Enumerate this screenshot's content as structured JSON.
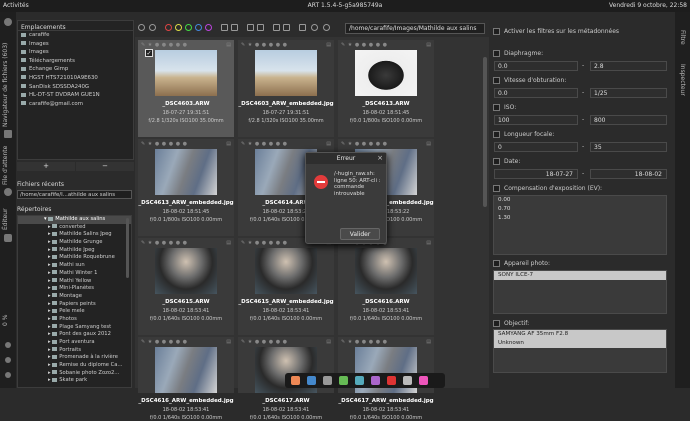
{
  "topbar": {
    "apps": "Activités",
    "title": "ART 1.5.4-5-g5a985749a",
    "clock": "Vendredi 9 octobre, 22:58"
  },
  "left_tabs": {
    "navigator": "Navigateur de fichiers (603)",
    "queue": "File d'attente",
    "editor": "Éditeur"
  },
  "zoom_pct": "0 %",
  "places": {
    "header": "Emplacements",
    "items": [
      "carafife",
      "Images",
      "Images",
      "Téléchargements",
      "Echange Gimp",
      "HGST HTS721010A9E630",
      "SanDisk SDSSDA240G",
      "HL-DT-ST DVDRAM GUE1N",
      "carafife@gmail.com"
    ],
    "add": "+",
    "remove": "−"
  },
  "recent": {
    "label": "Fichiers récents",
    "value": "/home/carafife/I...athilde aux salins"
  },
  "directories": {
    "label": "Répertoires",
    "items": [
      {
        "t": "Mathilde aux salins",
        "sel": true
      },
      {
        "t": "converted"
      },
      {
        "t": "Mathilde Salins Jpeg"
      },
      {
        "t": "Mathilde Grunge"
      },
      {
        "t": "Mathilde Jpeg"
      },
      {
        "t": "Mathilde Roquebrune"
      },
      {
        "t": "Mathi sun"
      },
      {
        "t": "Mathi Winter 1"
      },
      {
        "t": "Mathi Yellow"
      },
      {
        "t": "Mini-Planètes"
      },
      {
        "t": "Montage"
      },
      {
        "t": "Papiers peints"
      },
      {
        "t": "Pele mele"
      },
      {
        "t": "Photos"
      },
      {
        "t": "Plage Samyang test"
      },
      {
        "t": "Pont des gaux 2012"
      },
      {
        "t": "Port aventura"
      },
      {
        "t": "Portraits"
      },
      {
        "t": "Promenade à la rivière"
      },
      {
        "t": "Remise du diplome Ca..."
      },
      {
        "t": "Sobanie photo Zozo2..."
      },
      {
        "t": "Skate park"
      }
    ]
  },
  "toolbar": {
    "path": "/home/carafife/Images/Mathilde aux salins"
  },
  "thumbnails": [
    {
      "name": "_DSC4603.ARW",
      "date": "18-07-27 19:31:51",
      "exif": "f/2.8 1/320s ISO100 35.00mm",
      "sel": true,
      "img": "beach"
    },
    {
      "name": "_DSC4603_ARW_embedded.jpg",
      "date": "18-07-27 19:31:51",
      "exif": "f/2.8 1/320s ISO100 35.00mm",
      "img": "beach"
    },
    {
      "name": "_DSC4613.ARW",
      "date": "18-08-02 18:51:45",
      "exif": "f/0.0 1/800s ISO100 0.00mm",
      "img": "dark"
    },
    {
      "name": "_DSC4613_ARW_embedded.jpg",
      "date": "18-08-02 18:51:45",
      "exif": "f/0.0 1/800s ISO100 0.00mm",
      "img": "graffiti"
    },
    {
      "name": "_DSC4614.ARW",
      "date": "18-08-02 18:53:22",
      "exif": "f/0.0 1/640s ISO100 0.00mm",
      "img": "graffiti"
    },
    {
      "name": "_DSC4614_ARW_embedded.jpg",
      "date": "18-08-02 18:53:22",
      "exif": "f/0.0 1/640s ISO100 0.00mm",
      "img": "graffiti"
    },
    {
      "name": "_DSC4615.ARW",
      "date": "18-08-02 18:53:41",
      "exif": "f/0.0 1/640s ISO100 0.00mm",
      "img": "portrait"
    },
    {
      "name": "_DSC4615_ARW_embedded.jpg",
      "date": "18-08-02 18:53:41",
      "exif": "f/0.0 1/640s ISO100 0.00mm",
      "img": "portrait"
    },
    {
      "name": "_DSC4616.ARW",
      "date": "18-08-02 18:53:41",
      "exif": "f/0.0 1/640s ISO100 0.00mm",
      "img": "portrait"
    },
    {
      "name": "_DSC4616_ARW_embedded.jpg",
      "date": "18-08-02 18:53:41",
      "exif": "f/0.0 1/640s ISO100 0.00mm",
      "img": "graffiti"
    },
    {
      "name": "_DSC4617.ARW",
      "date": "18-08-02 18:53:41",
      "exif": "f/0.0 1/640s ISO100 0.00mm",
      "img": "portrait"
    },
    {
      "name": "_DSC4617_ARW_embedded.jpg",
      "date": "18-08-02 18:53:41",
      "exif": "f/0.0 1/640s ISO100 0.00mm",
      "img": "graffiti"
    }
  ],
  "dialog": {
    "title": "Erreur",
    "message": "/-hugin_raw.sh: ligne 50: ART-cli : commande introuvable",
    "button": "Valider"
  },
  "filters": {
    "metadata": "Activer les filtres sur les métadonnées",
    "aperture": "Diaphragme:",
    "ap_min": "0.0",
    "ap_max": "2.8",
    "shutter": "Vitesse d'obturation:",
    "sh_min": "0.0",
    "sh_max": "1/25",
    "iso": "ISO:",
    "iso_min": "100",
    "iso_max": "800",
    "focal": "Longueur focale:",
    "fl_min": "0",
    "fl_max": "35",
    "date": "Date:",
    "date_min": "18-07-27",
    "date_max": "18-08-02",
    "ev": "Compensation d'exposition (EV):",
    "ev_values": [
      "0.00",
      "0.70",
      "1.30"
    ],
    "camera": "Appareil photo:",
    "camera_value": "SONY ILCE-7",
    "lens": "Objectif:",
    "lens_values": [
      "SAMYANG AF 35mm F2.8",
      "Unknown"
    ]
  },
  "right_tabs": {
    "filter": "Filtre",
    "inspector": "Inspecteur"
  }
}
